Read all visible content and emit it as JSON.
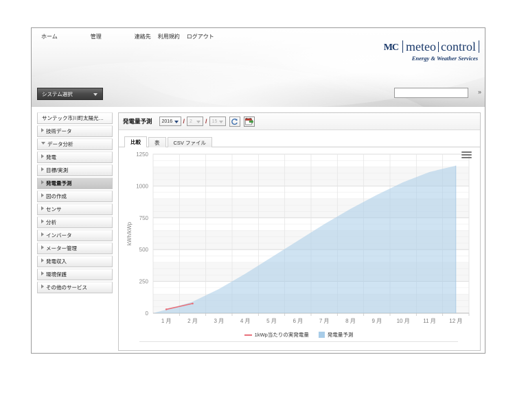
{
  "topnav": {
    "items": [
      {
        "label": "ホーム",
        "name": "nav-home"
      },
      {
        "label": "管理",
        "name": "nav-admin"
      },
      {
        "label": "連絡先",
        "name": "nav-contact"
      },
      {
        "label": "利用規約",
        "name": "nav-terms"
      },
      {
        "label": "ログアウト",
        "name": "nav-logout"
      }
    ]
  },
  "logo": {
    "mark": "mc",
    "word1": "meteo",
    "word2": "control",
    "tagline": "Energy & Weather Services",
    "color": "#1b3a6b"
  },
  "sysbar": {
    "system_select_label": "システム選択",
    "search_value": "",
    "search_placeholder": "",
    "go_label": "»"
  },
  "sidebar": {
    "items": [
      {
        "label": "サンテック市川町太陽光…",
        "type": "head",
        "expanded": false,
        "active": false
      },
      {
        "label": "技術データ",
        "type": "branch",
        "expanded": false,
        "active": false
      },
      {
        "label": "データ分析",
        "type": "branch",
        "expanded": true,
        "active": false
      },
      {
        "label": "発電",
        "type": "branch",
        "expanded": false,
        "active": false
      },
      {
        "label": "目標/実測",
        "type": "branch",
        "expanded": false,
        "active": false
      },
      {
        "label": "発電量予測",
        "type": "branch",
        "expanded": false,
        "active": true
      },
      {
        "label": "図の作成",
        "type": "branch",
        "expanded": false,
        "active": false
      },
      {
        "label": "センサ",
        "type": "branch",
        "expanded": false,
        "active": false
      },
      {
        "label": "分析",
        "type": "branch",
        "expanded": false,
        "active": false
      },
      {
        "label": "インバータ",
        "type": "branch",
        "expanded": false,
        "active": false
      },
      {
        "label": "メーター管理",
        "type": "branch",
        "expanded": false,
        "active": false
      },
      {
        "label": "発電収入",
        "type": "branch",
        "expanded": false,
        "active": false
      },
      {
        "label": "環境保護",
        "type": "branch",
        "expanded": false,
        "active": false
      },
      {
        "label": "その他のサービス",
        "type": "branch",
        "expanded": false,
        "active": false
      }
    ]
  },
  "toolbar": {
    "title": "発電量予測",
    "year_value": "2016",
    "month_value": "2",
    "day_value": "15",
    "separator": "/",
    "refresh_icon": "refresh-icon",
    "calendar_icon": "calendar-export-icon"
  },
  "tabs": [
    {
      "label": "比較",
      "name": "tab-comparison",
      "active": true
    },
    {
      "label": "表",
      "name": "tab-table",
      "active": false
    },
    {
      "label": "CSV ファイル",
      "name": "tab-csv",
      "active": false
    }
  ],
  "chart_data": {
    "type": "area",
    "title": "",
    "xlabel": "",
    "ylabel": "kWh/kWp",
    "ylim": [
      0,
      1250
    ],
    "yticks": [
      0,
      250,
      500,
      750,
      1000,
      1250
    ],
    "grid": true,
    "legend_position": "bottom",
    "categories": [
      "1 月",
      "2 月",
      "3 月",
      "4 月",
      "5 月",
      "6 月",
      "7 月",
      "8 月",
      "9 月",
      "10 月",
      "11 月",
      "12 月"
    ],
    "series": [
      {
        "name": "発電量予測",
        "type": "area",
        "color": "#a8cce8",
        "values": [
          28,
          90,
          190,
          310,
          440,
          570,
          700,
          820,
          930,
          1030,
          1110,
          1160
        ]
      },
      {
        "name": "1kWp当たりの実発電量",
        "type": "line",
        "color": "#e8707a",
        "values": [
          30,
          76,
          null,
          null,
          null,
          null,
          null,
          null,
          null,
          null,
          null,
          null
        ]
      }
    ]
  },
  "chart_ui": {
    "export_menu_icon": "hamburger-menu-icon"
  }
}
